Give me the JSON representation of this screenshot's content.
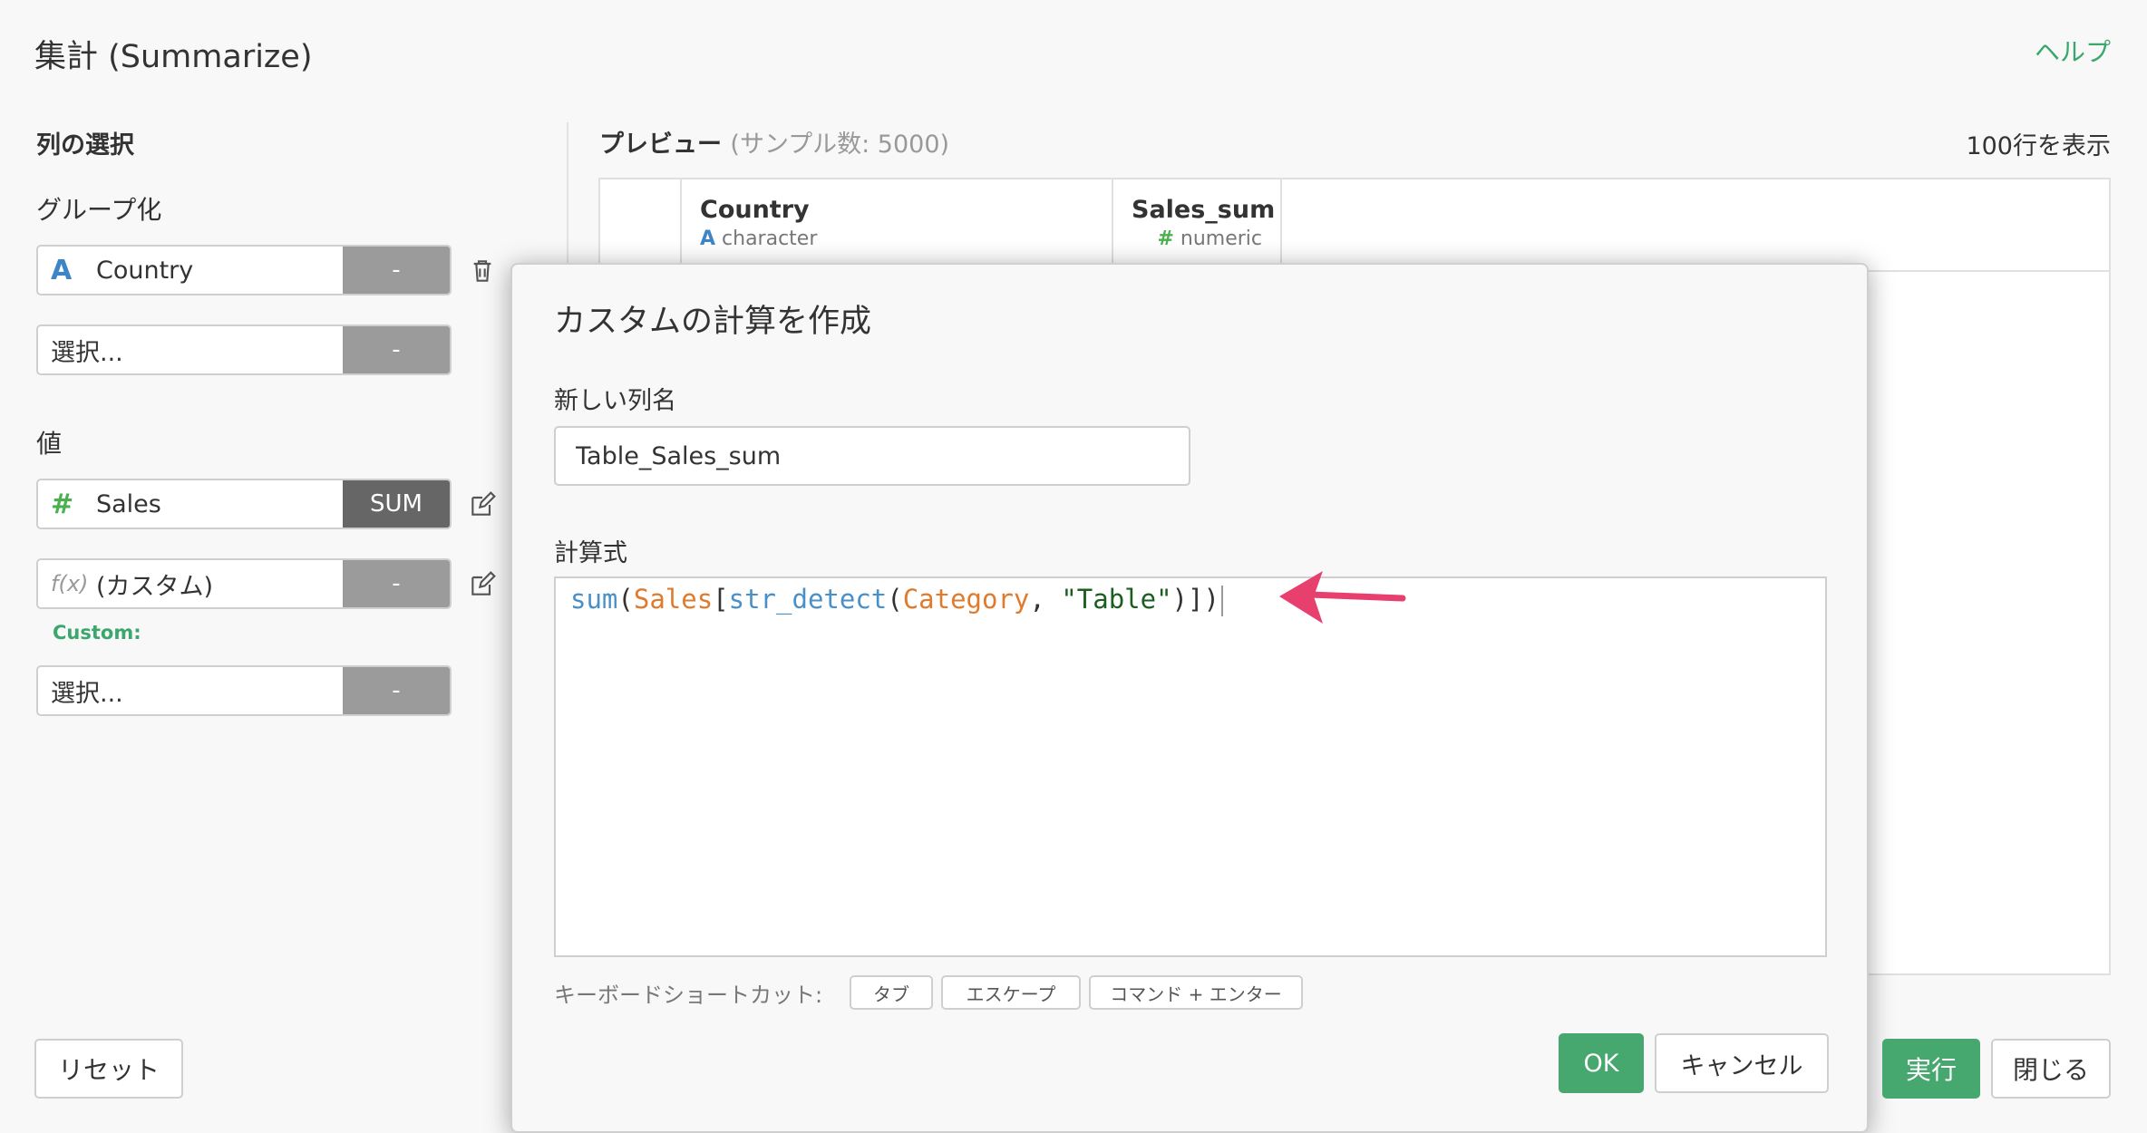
{
  "page": {
    "title": "集計 (Summarize)",
    "help_label": "ヘルプ"
  },
  "left_panel": {
    "section_title": "列の選択",
    "group_label": "グループ化",
    "group_fields": [
      {
        "type_icon": "A",
        "name": "Country",
        "agg": "-"
      },
      {
        "name": "選択...",
        "agg": "-"
      }
    ],
    "value_label": "値",
    "value_fields": [
      {
        "type_icon": "#",
        "name": "Sales",
        "agg": "SUM"
      },
      {
        "type_icon": "f(x)",
        "name": "(カスタム)",
        "agg": "-"
      },
      {
        "name": "選択...",
        "agg": "-"
      }
    ],
    "custom_label": "Custom:"
  },
  "preview": {
    "title": "プレビュー",
    "sample_info": "(サンプル数: 5000)",
    "rows_info": "100行を表示",
    "columns": [
      {
        "icon": "A",
        "name": "Country",
        "type": "character"
      },
      {
        "icon": "#",
        "name": "Sales_sum",
        "type": "numeric"
      }
    ]
  },
  "modal": {
    "title": "カスタムの計算を作成",
    "name_label": "新しい列名",
    "name_value": "Table_Sales_sum",
    "formula_label": "計算式",
    "formula": {
      "fn_sum": "sum",
      "paren_open": "(",
      "col_sales": "Sales",
      "bracket_open": "[",
      "fn_detect": "str_detect",
      "paren_open2": "(",
      "col_category": "Category",
      "comma": ", ",
      "str_table": "\"Table\"",
      "close": ")])"
    },
    "shortcut_label": "キーボードショートカット:",
    "shortcuts": [
      "タブ",
      "エスケープ",
      "コマンド + エンター"
    ],
    "ok_label": "OK",
    "cancel_label": "キャンセル"
  },
  "footer": {
    "reset_label": "リセット",
    "run_label": "実行",
    "close_label": "閉じる"
  },
  "colors": {
    "accent": "#47a86f",
    "arrow": "#e8406e"
  }
}
